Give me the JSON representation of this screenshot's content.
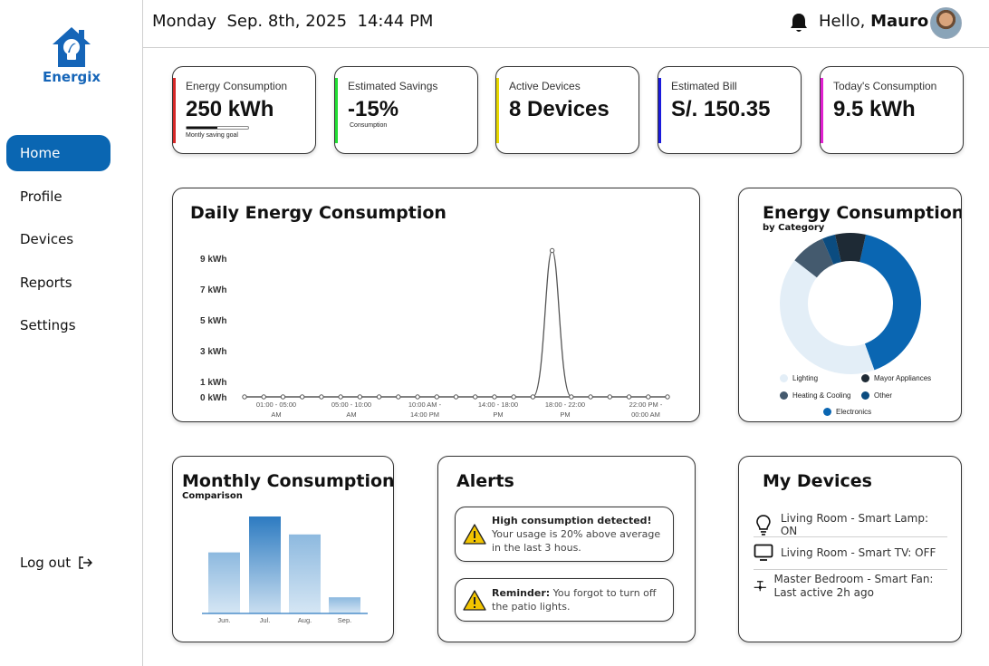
{
  "app": {
    "name": "Energix"
  },
  "sidebar": {
    "items": [
      {
        "label": "Home",
        "active": true
      },
      {
        "label": "Profile"
      },
      {
        "label": "Devices"
      },
      {
        "label": "Reports"
      },
      {
        "label": "Settings"
      }
    ],
    "logout_label": "Log out"
  },
  "header": {
    "date": "Monday  Sep. 8th, 2025  14:44 PM",
    "greeting": "Hello, ",
    "user_name": "Mauro"
  },
  "stats": [
    {
      "label": "Energy Consumption",
      "value": "250 kWh",
      "color": "#d62828",
      "progress": 0.5,
      "note": "Montly saving goal"
    },
    {
      "label": "Estimated Savings",
      "value": "-15%",
      "color": "#22dd33",
      "note": "Consumption"
    },
    {
      "label": "Active Devices",
      "value": "8 Devices",
      "color": "#e8d800"
    },
    {
      "label": "Estimated Bill",
      "value": "S/. 150.35",
      "color": "#1a1adc"
    },
    {
      "label": "Today's Consumption",
      "value": "9.5 kWh",
      "color": "#e020d0"
    }
  ],
  "daily": {
    "title": "Daily Energy Consumption",
    "y_ticks": [
      "9 kWh",
      "7 kWh",
      "5 kWh",
      "3 kWh",
      "1 kWh",
      "0 kWh"
    ],
    "x_ticks": [
      [
        "01:00 - 05:00",
        "AM"
      ],
      [
        "05:00 - 10:00",
        "AM"
      ],
      [
        "10:00 AM -",
        "14:00 PM"
      ],
      [
        "14:00 - 18:00",
        "PM"
      ],
      [
        "18:00 - 22:00",
        "PM"
      ],
      [
        "22:00 PM -",
        "00:00 AM"
      ]
    ]
  },
  "chart_data": [
    {
      "type": "line",
      "title": "Daily Energy Consumption",
      "y_ticks": [
        0,
        1,
        3,
        5,
        7,
        9
      ],
      "ylabel_unit": "kWh",
      "values": [
        0,
        0,
        0,
        0,
        0,
        0,
        0,
        0,
        0,
        0,
        0,
        0,
        0,
        0,
        0,
        0,
        9.5,
        0,
        0,
        0,
        0,
        0,
        0
      ],
      "peak_index": 16
    },
    {
      "type": "pie",
      "title": "Energy Consumption",
      "subtitle": "by Category",
      "categories": [
        "Electronics",
        "Lighting",
        "Heating & Cooling",
        "Other",
        "Mayor Appliances"
      ],
      "values": [
        41,
        41,
        8,
        3,
        7
      ],
      "colors": [
        "#0a66b2",
        "#e3eef7",
        "#445a6e",
        "#0b4c80",
        "#1e2a35"
      ]
    },
    {
      "type": "bar",
      "title": "Monthly Consumption",
      "subtitle": "Comparison",
      "categories": [
        "Jun.",
        "Jul.",
        "Aug.",
        "Sep."
      ],
      "values": [
        68,
        108,
        88,
        18
      ]
    }
  ],
  "donut": {
    "title": "Energy Consumption",
    "subtitle": "by Category",
    "legend": [
      "Lighting",
      "Mayor Appliances",
      "Heating & Cooling",
      "Other",
      "Electronics"
    ]
  },
  "monthly": {
    "title": "Monthly Consumption",
    "subtitle": "Comparison"
  },
  "alerts": {
    "title": "Alerts",
    "items": [
      {
        "bold": "High consumption detected!",
        "text": "Your usage is 20% above average in the last 3 hous."
      },
      {
        "bold": "Reminder:",
        "text": " You forgot to turn off the patio lights."
      }
    ]
  },
  "devices": {
    "title": "My Devices",
    "items": [
      {
        "icon": "lamp-icon",
        "label": "Living Room - Smart Lamp: ON"
      },
      {
        "icon": "tv-icon",
        "label": "Living Room - Smart TV: OFF"
      },
      {
        "icon": "fan-icon",
        "label": "Master Bedroom - Smart Fan: Last active 2h ago"
      }
    ]
  }
}
